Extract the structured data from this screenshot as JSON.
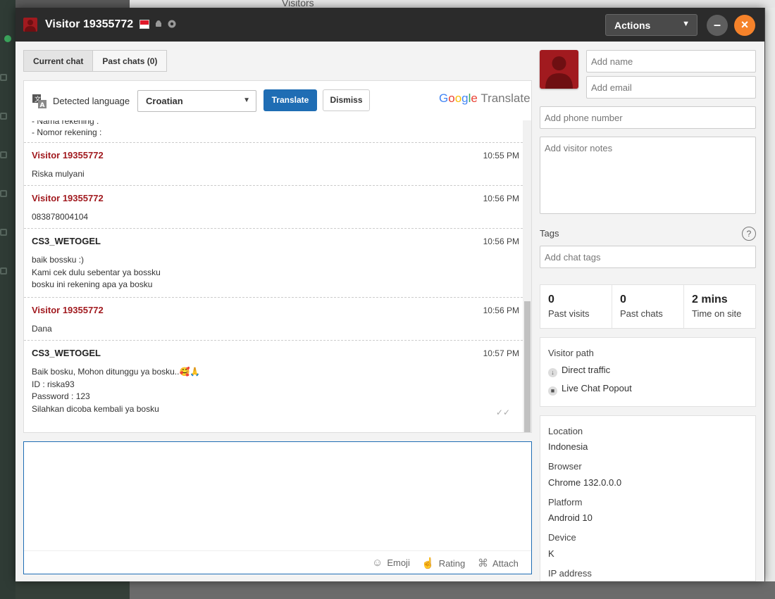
{
  "background": {
    "title": "Visitors"
  },
  "window": {
    "title": "Visitor 19355772",
    "actions_label": "Actions",
    "minimize_glyph": "–",
    "close_glyph": "×"
  },
  "tabs": [
    {
      "label": "Current chat",
      "active": true
    },
    {
      "label": "Past chats (0)",
      "active": false
    }
  ],
  "translate": {
    "label": "Detected language",
    "language": "Croatian",
    "translate_label": "Translate",
    "dismiss_label": "Dismiss",
    "brand_google": "Google",
    "brand_translate": "Translate"
  },
  "chat": {
    "previous_tail": [
      "- Nama rekening :",
      "- Nomor rekening :"
    ],
    "messages": [
      {
        "author": "Visitor 19355772",
        "role": "visitor",
        "time": "10:55 PM",
        "lines": [
          "Riska mulyani"
        ]
      },
      {
        "author": "Visitor 19355772",
        "role": "visitor",
        "time": "10:56 PM",
        "lines": [
          "083878004104"
        ]
      },
      {
        "author": "CS3_WETOGEL",
        "role": "agent",
        "time": "10:56 PM",
        "lines": [
          "baik bossku :)",
          "Kami cek dulu sebentar ya bossku",
          "bosku ini rekening apa ya bosku"
        ]
      },
      {
        "author": "Visitor 19355772",
        "role": "visitor",
        "time": "10:56 PM",
        "lines": [
          "Dana"
        ]
      },
      {
        "author": "CS3_WETOGEL",
        "role": "agent",
        "time": "10:57 PM",
        "lines": [
          "Baik bosku, Mohon ditunggu ya bosku..🥰🙏",
          "ID : riska93",
          "Password : 123",
          "Silahkan dicoba kembali ya bosku"
        ]
      }
    ]
  },
  "composer": {
    "emoji_label": "Emoji",
    "rating_label": "Rating",
    "attach_label": "Attach"
  },
  "visitor_info": {
    "name_placeholder": "Add name",
    "email_placeholder": "Add email",
    "phone_placeholder": "Add phone number",
    "notes_placeholder": "Add visitor notes",
    "tags_label": "Tags",
    "tags_placeholder": "Add chat tags",
    "help_glyph": "?"
  },
  "stats": [
    {
      "value": "0",
      "label": "Past visits"
    },
    {
      "value": "0",
      "label": "Past chats"
    },
    {
      "value": "2 mins",
      "label": "Time on site"
    }
  ],
  "visitor_path": {
    "label": "Visitor path",
    "items": [
      "Direct traffic",
      "Live Chat Popout"
    ]
  },
  "details": {
    "location_label": "Location",
    "location": "Indonesia",
    "browser_label": "Browser",
    "browser": "Chrome 132.0.0.0",
    "platform_label": "Platform",
    "platform": "Android 10",
    "device_label": "Device",
    "device": "K",
    "ip_label": "IP address"
  },
  "colors": {
    "accent_blue": "#1f6db4",
    "visitor_red": "#a11a1f",
    "close_orange": "#f5822a",
    "titlebar": "#2b2b2b"
  }
}
